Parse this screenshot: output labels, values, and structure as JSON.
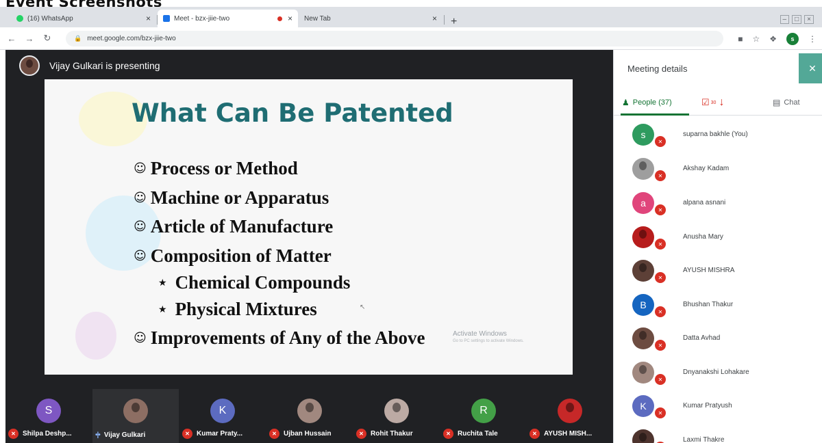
{
  "heading": "Event Screenshots",
  "browser": {
    "tabs": [
      {
        "title": "(16) WhatsApp",
        "fav_color": "#25d366"
      },
      {
        "title": "Meet - bzx-jiie-two",
        "fav_color": "#1a73e8",
        "recording": true
      },
      {
        "title": "New Tab",
        "fav_color": "#dee1e6"
      }
    ],
    "close_glyph": "×",
    "new_tab_glyph": "+",
    "url": "meet.google.com/bzx-jiie-two",
    "profile_initial": "s"
  },
  "meet": {
    "presenter_text": "Vijay Gulkari is presenting",
    "slide": {
      "title": "What Can Be Patented",
      "bullets": [
        {
          "text": "Process or Method",
          "marker": "smiley"
        },
        {
          "text": "Machine or Apparatus",
          "marker": "smiley"
        },
        {
          "text": "Article of Manufacture",
          "marker": "smiley"
        },
        {
          "text": "Composition of Matter",
          "marker": "smiley"
        },
        {
          "text": "Chemical Compounds",
          "marker": "star"
        },
        {
          "text": "Physical Mixtures",
          "marker": "star"
        },
        {
          "text": "Improvements of Any of the Above",
          "marker": "smiley"
        }
      ],
      "smiley_glyph": "☺",
      "star_glyph": "★",
      "watermark_line1": "Activate Windows",
      "watermark_line2": "Go to PC settings to activate Windows."
    },
    "tiles": [
      {
        "name": "Shilpa Deshp...",
        "initial": "S",
        "color": "#7e57c2",
        "state": "muted"
      },
      {
        "name": "Vijay Gulkari",
        "initial": "",
        "color": "#8d6e63",
        "state": "speaking",
        "photo": true
      },
      {
        "name": "Kumar Praty...",
        "initial": "K",
        "color": "#5c6bc0",
        "state": "muted"
      },
      {
        "name": "Ujban Hussain",
        "initial": "",
        "color": "#a1887f",
        "state": "muted",
        "photo": true
      },
      {
        "name": "Rohit Thakur",
        "initial": "",
        "color": "#bcaaa4",
        "state": "muted",
        "photo": true
      },
      {
        "name": "Ruchita Tale",
        "initial": "R",
        "color": "#43a047",
        "state": "muted"
      },
      {
        "name": "AYUSH MISH...",
        "initial": "",
        "color": "#c62828",
        "state": "muted",
        "photo": true
      }
    ]
  },
  "panel": {
    "title": "Meeting details",
    "close_glyph": "✕",
    "tabs": {
      "people": "People (37)",
      "tasks_count": "30",
      "chat": "Chat"
    },
    "people": [
      {
        "name": "suparna bakhle (You)",
        "initial": "s",
        "color": "#2e9b5f"
      },
      {
        "name": "Akshay Kadam",
        "initial": "",
        "color": "#9e9e9e",
        "photo": true
      },
      {
        "name": "alpana asnani",
        "initial": "a",
        "color": "#e0457b"
      },
      {
        "name": "Anusha Mary",
        "initial": "",
        "color": "#b71c1c",
        "photo": true
      },
      {
        "name": "AYUSH MISHRA",
        "initial": "",
        "color": "#5d4037",
        "photo": true
      },
      {
        "name": "Bhushan Thakur",
        "initial": "B",
        "color": "#1565c0"
      },
      {
        "name": "Datta Avhad",
        "initial": "",
        "color": "#6d4c41",
        "photo": true
      },
      {
        "name": "Dnyanakshi Lohakare",
        "initial": "",
        "color": "#a1887f",
        "photo": true
      },
      {
        "name": "Kumar Pratyush",
        "initial": "K",
        "color": "#5c6bc0"
      },
      {
        "name": "Laxmi Thakre",
        "initial": "",
        "color": "#4e342e",
        "photo": true
      }
    ]
  }
}
